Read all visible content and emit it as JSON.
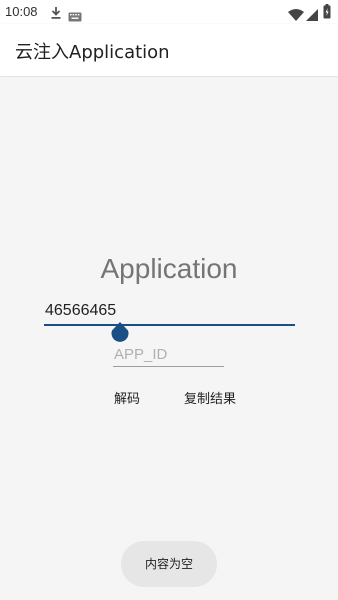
{
  "status_bar": {
    "time": "10:08",
    "icons": [
      "download-icon",
      "keyboard-icon",
      "wifi-icon",
      "signal-icon",
      "battery-icon"
    ]
  },
  "app_bar": {
    "title": "云注入Application"
  },
  "main": {
    "heading": "Application",
    "decode_input": {
      "value": "46566465"
    },
    "appid_input": {
      "value": "",
      "placeholder": "APP_ID"
    },
    "decode_button": "解码",
    "copy_button": "复制结果"
  },
  "toast": {
    "message": "内容为空"
  },
  "colors": {
    "accent": "#1a4f86",
    "background": "#f5f5f5",
    "surface": "#ffffff",
    "toast_background": "#e6e6e6"
  }
}
